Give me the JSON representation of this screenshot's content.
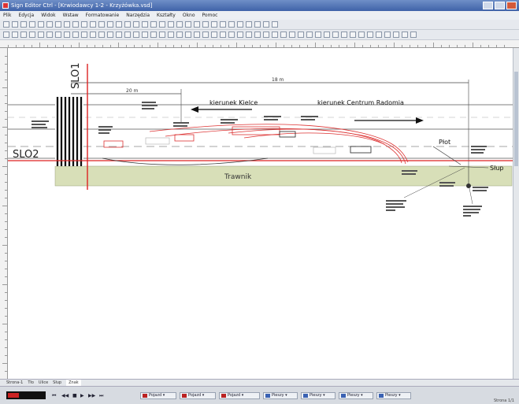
{
  "window": {
    "title": "Sign Editor Ctrl - [Krwiodawcy 1-2 - Krzyżówka.vsd]"
  },
  "menu": [
    "Plik",
    "Edycja",
    "Widok",
    "Wstaw",
    "Formatowanie",
    "Narzędzia",
    "Kształty",
    "Okno",
    "Pomoc"
  ],
  "drawing": {
    "label_slo1": "SLO1",
    "label_slo2": "SLO2",
    "dir_kielce": "kierunek Kielce",
    "dir_centrum": "kierunek Centrum Radomia",
    "trawnik": "Trawnik",
    "plot": "Płot",
    "slup": "Słup",
    "dim_top": "18 m",
    "dim_left": "20 m"
  },
  "tabs": [
    "Strona-1",
    "Tło",
    "Ulice",
    "Słup",
    "Znak"
  ],
  "tabs_active": "Znak",
  "statusbar": {
    "dropdowns": [
      "Pojazd",
      "Pojazd",
      "Pojazd",
      "Pieszy",
      "Pieszy",
      "Pieszy",
      "Pieszy"
    ],
    "page_info": "Strona 1/1"
  }
}
